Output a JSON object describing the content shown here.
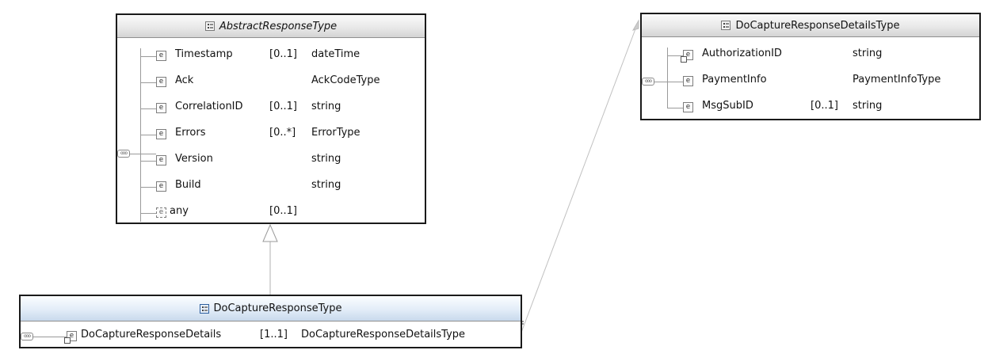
{
  "abstract": {
    "title": "AbstractResponseType",
    "rows": [
      {
        "name": "Timestamp",
        "card": "[0..1]",
        "type": "dateTime"
      },
      {
        "name": "Ack",
        "card": "",
        "type": "AckCodeType"
      },
      {
        "name": "CorrelationID",
        "card": "[0..1]",
        "type": "string"
      },
      {
        "name": "Errors",
        "card": "[0..*]",
        "type": "ErrorType"
      },
      {
        "name": "Version",
        "card": "",
        "type": "string"
      },
      {
        "name": "Build",
        "card": "",
        "type": "string"
      },
      {
        "name": "any",
        "card": "[0..1]",
        "type": ""
      }
    ]
  },
  "details": {
    "title": "DoCaptureResponseDetailsType",
    "rows": [
      {
        "name": "AuthorizationID",
        "card": "",
        "type": "string"
      },
      {
        "name": "PaymentInfo",
        "card": "",
        "type": "PaymentInfoType"
      },
      {
        "name": "MsgSubID",
        "card": "[0..1]",
        "type": "string"
      }
    ]
  },
  "response": {
    "title": "DoCaptureResponseType",
    "row": {
      "name": "DoCaptureResponseDetails",
      "card": "[1..1]",
      "type": "DoCaptureResponseDetailsType"
    }
  },
  "icons": {
    "element": "e",
    "sequence": "ooo"
  }
}
